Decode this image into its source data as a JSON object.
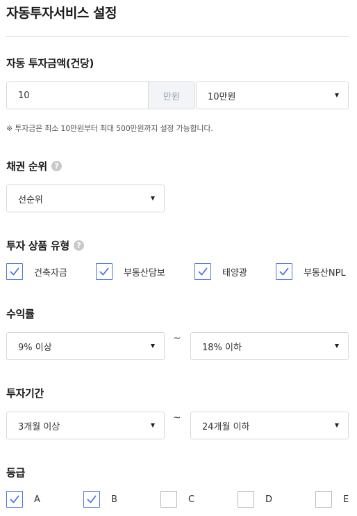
{
  "page": {
    "title": "자동투자서비스 설정"
  },
  "amount": {
    "label": "자동 투자금액(건당)",
    "input_value": "10",
    "unit": "만원",
    "preset_selected": "10만원",
    "note": "※ 투자금은 최소 10만원부터 최대 500만원까지 설정 가능합니다."
  },
  "priority": {
    "label": "채권 순위",
    "help": "?",
    "selected": "선순위"
  },
  "product_type": {
    "label": "투자 상품 유형",
    "help": "?",
    "options": [
      {
        "label": "건축자금",
        "checked": true
      },
      {
        "label": "부동산담보",
        "checked": true
      },
      {
        "label": "태양광",
        "checked": true
      },
      {
        "label": "부동산NPL",
        "checked": true
      }
    ]
  },
  "yield": {
    "label": "수익률",
    "min_selected": "9% 이상",
    "separator": "~",
    "max_selected": "18% 이하"
  },
  "period": {
    "label": "투자기간",
    "min_selected": "3개월 이상",
    "separator": "~",
    "max_selected": "24개월 이하"
  },
  "grade": {
    "label": "등급",
    "options": [
      {
        "label": "A",
        "checked": true
      },
      {
        "label": "B",
        "checked": true
      },
      {
        "label": "C",
        "checked": false
      },
      {
        "label": "D",
        "checked": false
      },
      {
        "label": "E",
        "checked": false
      }
    ]
  },
  "colors": {
    "accent": "#4a72e8",
    "border": "#d9d9d9",
    "unit_bg": "#f2f4f7"
  }
}
